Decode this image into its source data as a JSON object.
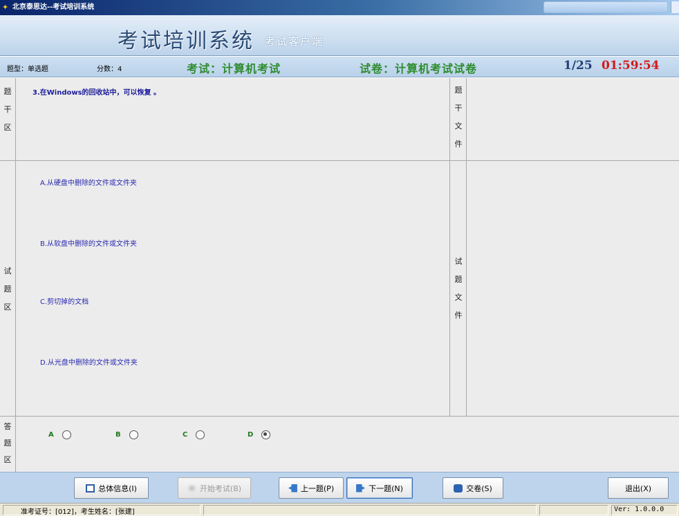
{
  "window": {
    "title": "北京泰思达--考试培训系统"
  },
  "header": {
    "title": "考试培训系统",
    "subtitle": "考试客户端"
  },
  "info": {
    "type_label": "题型：单选题",
    "score_label": "分数：4",
    "exam_label": "考试：计算机考试",
    "paper_label": "试卷：计算机考试试卷",
    "progress": "1/25",
    "timer": "01:59:54"
  },
  "sections": {
    "stem": "题干区",
    "stem_file": "题干文件",
    "question": "试题区",
    "question_file": "试题文件",
    "answer": "答题区"
  },
  "question": {
    "text": "3.在Windows的回收站中，可以恢复     。",
    "options": [
      "A.从硬盘中删除的文件或文件夹",
      "B.从软盘中删除的文件或文件夹",
      "C.剪切掉的文档",
      "D.从光盘中删除的文件或文件夹"
    ]
  },
  "answers": {
    "letters": [
      "A",
      "B",
      "C",
      "D"
    ],
    "selected": "D"
  },
  "buttons": {
    "info": "总体信息(I)",
    "start": "开始考试(B)",
    "prev": "上一题(P)",
    "next": "下一题(N)",
    "submit": "交卷(S)",
    "exit": "退出(X)"
  },
  "status": {
    "text": "准考证号：[012]，考生姓名：[张建]",
    "version": "Ver: 1.0.0.0"
  },
  "colors": {
    "exam_green": "#2d8b2d",
    "timer_red": "#d41a1a",
    "question_blue": "#1b1b9a",
    "header_blue": "#2a4a75"
  }
}
